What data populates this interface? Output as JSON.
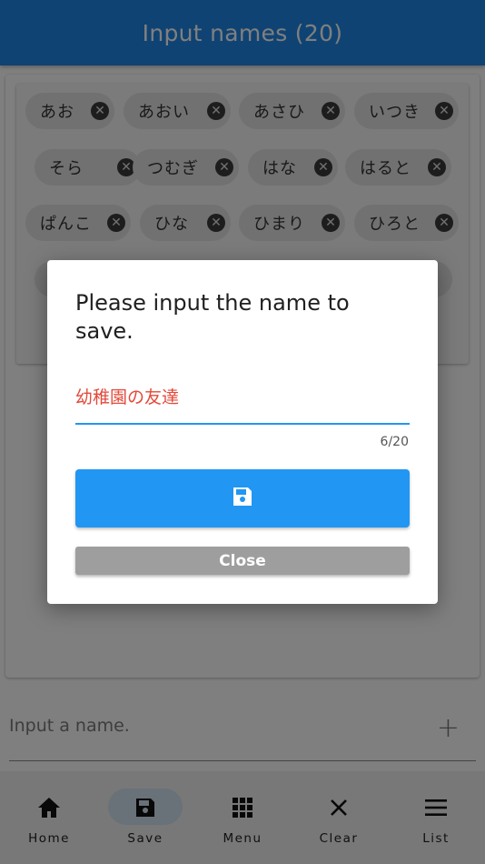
{
  "appbar": {
    "title": "Input names (20)"
  },
  "chips": [
    {
      "label": "あお"
    },
    {
      "label": "あおい"
    },
    {
      "label": "あさひ"
    },
    {
      "label": "いつき"
    },
    {
      "label": "そら"
    },
    {
      "label": "つむぎ"
    },
    {
      "label": "はな"
    },
    {
      "label": "はると"
    },
    {
      "label": "ぱんこ"
    },
    {
      "label": "ひな"
    },
    {
      "label": "ひまり"
    },
    {
      "label": "ひろと"
    }
  ],
  "name_input": {
    "placeholder": "Input a name."
  },
  "dialog": {
    "title": "Please input the name to save.",
    "field_value": "幼稚園の友達",
    "counter": "6/20",
    "save_icon": "save-icon",
    "close_label": "Close"
  },
  "bottom_nav": {
    "items": [
      {
        "label": "Home",
        "icon": "home-icon"
      },
      {
        "label": "Save",
        "icon": "save-icon"
      },
      {
        "label": "Menu",
        "icon": "grid-icon"
      },
      {
        "label": "Clear",
        "icon": "close-icon"
      },
      {
        "label": "List",
        "icon": "list-icon"
      }
    ]
  },
  "colors": {
    "primary": "#2196f3",
    "appbar": "#1f86e6",
    "error_text": "#e34a3a",
    "close_button": "#9e9e9e",
    "nav_pill": "#d3e3f2"
  }
}
